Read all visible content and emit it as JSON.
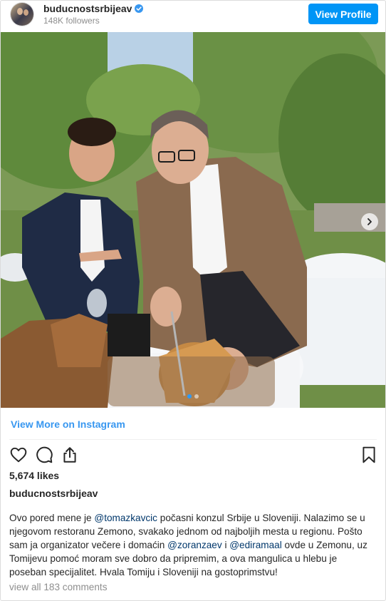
{
  "header": {
    "username": "buducnostsrbijeav",
    "followers": "148K followers",
    "view_profile_label": "View Profile"
  },
  "post": {
    "image_alt": "post photo",
    "carousel": {
      "slides": 2,
      "active_index": 0
    },
    "view_more_label": "View More on Instagram",
    "likes": "5,674 likes",
    "owner": "buducnostsrbijeav",
    "caption": [
      {
        "text": "Ovo pored mene je "
      },
      {
        "text": "@tomazkavcic",
        "mention": true
      },
      {
        "text": " počasni konzul Srbije u Sloveniji. Nalazimo se u njegovom restoranu Zemono, svakako jednom od najboljih mesta u regionu. Pošto sam ja organizator večere i domaćin "
      },
      {
        "text": "@zoranzaev",
        "mention": true
      },
      {
        "text": " i "
      },
      {
        "text": "@ediramaal",
        "mention": true
      },
      {
        "text": " ovde u Zemonu, uz Tomijevu pomoć moram sve dobro da pripremim, a ova mangulica u hlebu je poseban specijalitet. Hvala Tomiju i Sloveniji na gostoprimstvu!"
      }
    ],
    "comments_label": "view all 183 comments"
  },
  "icons": {
    "verified": "verified-badge-icon",
    "like": "heart-icon",
    "comment": "comment-bubble-icon",
    "share": "share-icon",
    "save": "bookmark-icon",
    "next": "chevron-right-icon"
  },
  "colors": {
    "accent": "#0095f6",
    "link": "#3897f0",
    "mention": "#00376b",
    "muted": "#8e8e8e"
  }
}
